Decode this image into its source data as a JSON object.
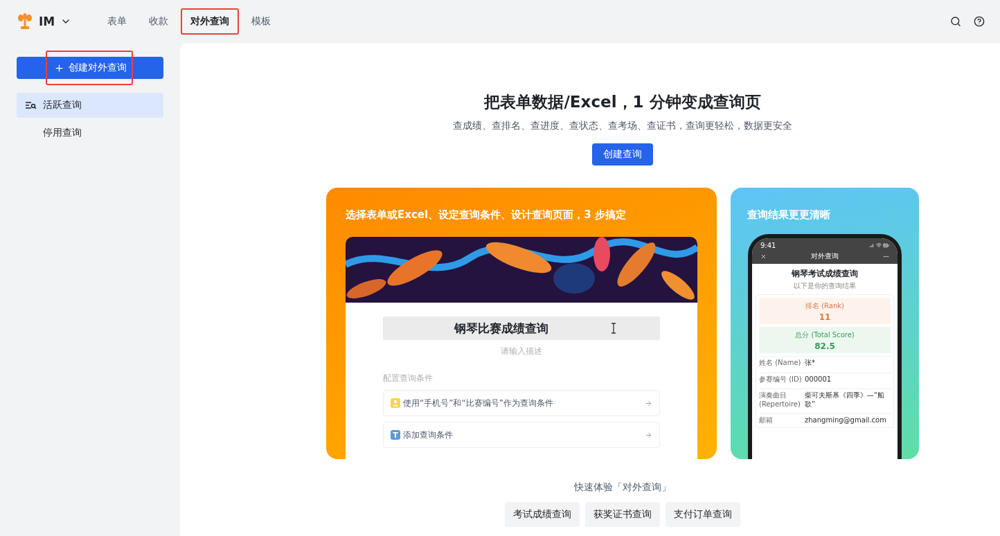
{
  "brand": {
    "name": "IM"
  },
  "nav_tabs": [
    {
      "label": "表单",
      "selected": false,
      "highlighted": false
    },
    {
      "label": "收款",
      "selected": false,
      "highlighted": false
    },
    {
      "label": "对外查询",
      "selected": true,
      "highlighted": true
    },
    {
      "label": "模板",
      "selected": false,
      "highlighted": false
    }
  ],
  "sidebar": {
    "create_button": {
      "label": "创建对外查询",
      "highlighted": true
    },
    "items": [
      {
        "label": "活跃查询",
        "selected": true
      },
      {
        "label": "停用查询",
        "selected": false
      }
    ]
  },
  "hero": {
    "title": "把表单数据/Excel，1 分钟变成查询页",
    "subtitle": "查成绩、查排名、查进度、查状态、查考场、查证书，查询更轻松，数据更安全",
    "button": "创建查询"
  },
  "steps_card": {
    "title": "选择表单或Excel、设定查询条件、设计查询页面，3 步搞定",
    "form_title": "钢琴比赛成绩查询",
    "description_placeholder": "请输入描述",
    "conditions_label": "配置查询条件",
    "conditions": [
      {
        "kind": "person",
        "label": "使用“手机号”和“比赛编号”作为查询条件"
      },
      {
        "kind": "text",
        "icon_label": "T",
        "label": "添加查询条件"
      }
    ]
  },
  "result_card": {
    "title": "查询结果更更清晰",
    "phone": {
      "time": "9:41",
      "nav_title": "对外查询",
      "page_title": "钢琴考试成绩查询",
      "page_subtitle": "以下是你的查询结果",
      "highlights": [
        {
          "kind": "rank",
          "label": "排名 (Rank)",
          "value": "11"
        },
        {
          "kind": "score",
          "label": "总分 (Total Score)",
          "value": "82.5"
        }
      ],
      "rows": [
        {
          "label": "姓名 (Name)",
          "value": "张*"
        },
        {
          "label": "参赛编号 (ID)",
          "value": "000001"
        },
        {
          "label": "演奏曲目 (Repertoire)",
          "value": "柴可夫斯基《四季》—“船歌”"
        },
        {
          "label": "邮箱",
          "value": "zhangming@gmail.com"
        }
      ]
    }
  },
  "quick_try": {
    "label": "快速体验「对外查询」",
    "buttons": [
      "考试成绩查询",
      "获奖证书查询",
      "支付订单查询"
    ]
  }
}
